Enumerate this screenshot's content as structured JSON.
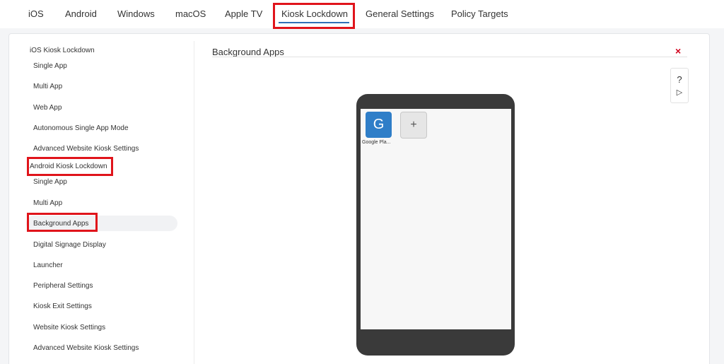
{
  "tabs": {
    "ios": "iOS",
    "android": "Android",
    "windows": "Windows",
    "macos": "macOS",
    "appletv": "Apple TV",
    "kiosk": "Kiosk Lockdown",
    "general": "General Settings",
    "policy": "Policy Targets"
  },
  "sidebar": {
    "ios_header": "iOS Kiosk Lockdown",
    "ios_items": [
      "Single App",
      "Multi App",
      "Web App",
      "Autonomous Single App Mode",
      "Advanced Website Kiosk Settings"
    ],
    "android_header": "Android Kiosk Lockdown",
    "android_items": [
      "Single App",
      "Multi App",
      "Background Apps",
      "Digital Signage Display",
      "Launcher",
      "Peripheral Settings",
      "Kiosk Exit Settings",
      "Website Kiosk Settings",
      "Advanced Website Kiosk Settings"
    ]
  },
  "content": {
    "title": "Background Apps",
    "close_symbol": "×",
    "help_symbol": "?",
    "play_symbol": "▷",
    "app_letter": "G",
    "app_label": "Google Pla...",
    "add_symbol": "+"
  },
  "colors": {
    "highlight": "#e0141b",
    "accent": "#2f6fb7",
    "close": "#d0021b",
    "app_tile": "#2f7ec8"
  }
}
